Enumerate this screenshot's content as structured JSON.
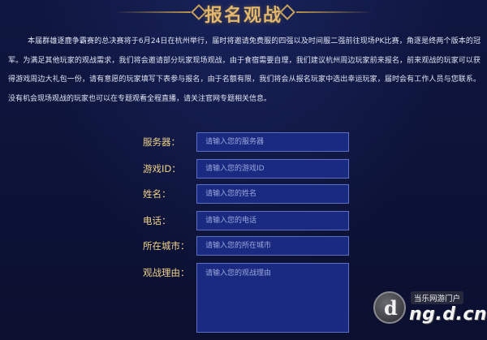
{
  "header": {
    "title": "报名观战"
  },
  "intro": {
    "text": "本届群雄逐鹿争霸赛的总决赛将于6月24日在杭州举行，届时将邀请免费服的四强以及时间服二强前往现场PK比赛，角逐是终两个版本的冠军。为满足其他玩家的观战需求，我们将会邀请部分玩家现场观战，由于食宿需要自理，我们建议杭州周边玩家前来报名，前来观战的玩家可以获得游戏周边大礼包一份，请有意愿的玩家填写下表参与报名，由于名额有限，我们将会从报名玩家中选出幸运玩家，届时会有工作人员与您联系。没有机会现场观战的玩家也可以在专题观看全程直播，请关注官网专题相关信息。"
  },
  "form": {
    "fields": [
      {
        "label": "服务器：",
        "placeholder": "请输入您的服务器"
      },
      {
        "label": "游戏ID：",
        "placeholder": "请输入您的游戏ID"
      },
      {
        "label": "姓名：",
        "placeholder": "请输入您的姓名"
      },
      {
        "label": "电话：",
        "placeholder": "请输入您的电话"
      },
      {
        "label": "所在城市：",
        "placeholder": "请输入您的所在城市"
      },
      {
        "label": "观战理由：",
        "placeholder": "请输入您的观战理由"
      }
    ]
  },
  "watermark": {
    "subtitle": "当乐网游门户",
    "site": "ng.d.cn",
    "logo_letter": "d"
  }
}
